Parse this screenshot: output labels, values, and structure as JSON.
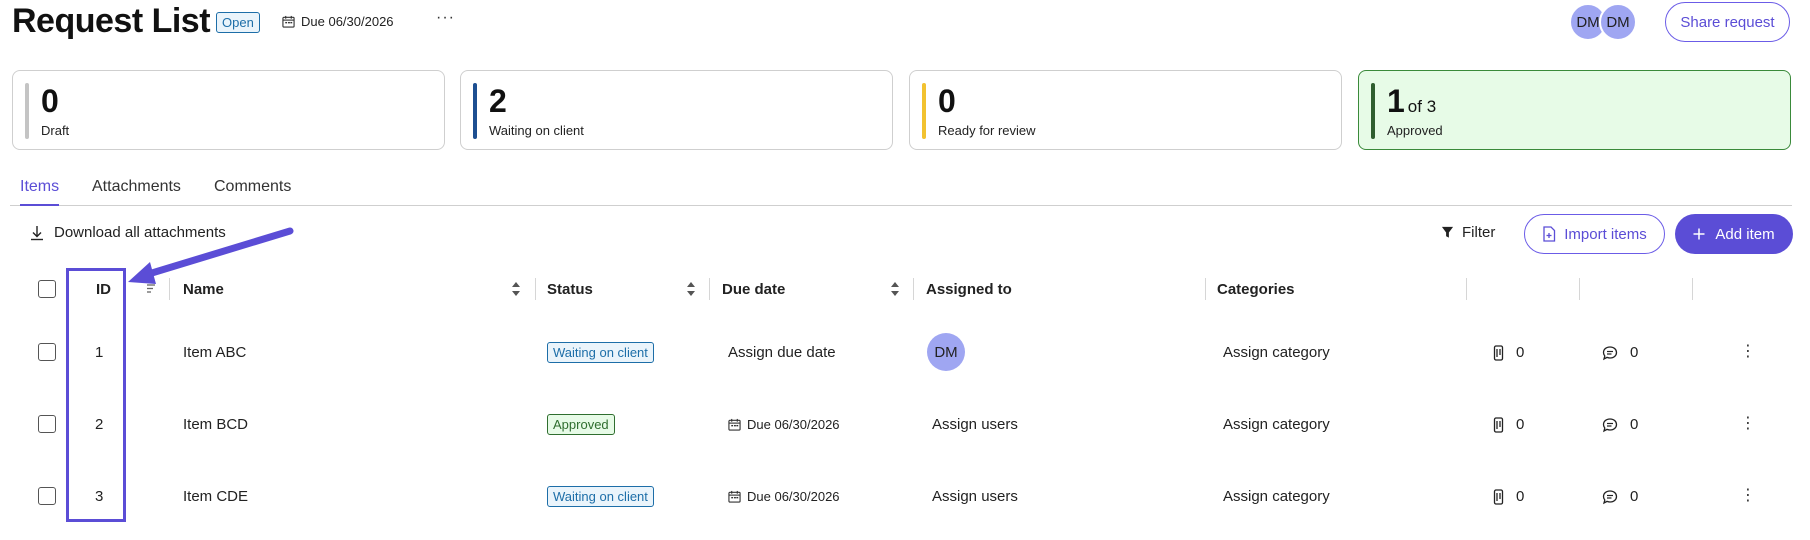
{
  "header": {
    "title": "Request List",
    "status": "Open",
    "due": "Due 06/30/2026",
    "more_label": "···",
    "avatars": [
      "DM",
      "DM"
    ],
    "share_label": "Share request"
  },
  "stats": [
    {
      "value": "0",
      "label": "Draft",
      "color": "#c4c4c4"
    },
    {
      "value": "2",
      "label": "Waiting on client",
      "color": "#1d4f91"
    },
    {
      "value": "0",
      "label": "Ready for review",
      "color": "#f2c230"
    },
    {
      "value": "1",
      "suffix": "of 3",
      "label": "Approved",
      "color": "#2f5e2f"
    }
  ],
  "tabs": [
    "Items",
    "Attachments",
    "Comments"
  ],
  "active_tab": "Items",
  "toolbar": {
    "download_label": "Download all attachments",
    "filter_label": "Filter",
    "import_label": "Import items",
    "add_label": "Add item"
  },
  "table": {
    "columns": [
      "ID",
      "Name",
      "Status",
      "Due date",
      "Assigned to",
      "Categories"
    ],
    "rows": [
      {
        "id": "1",
        "name": "Item ABC",
        "status": "Waiting on client",
        "due": "Assign due date",
        "assigned": "DM",
        "category": "Assign category",
        "attachments": "0",
        "comments": "0"
      },
      {
        "id": "2",
        "name": "Item BCD",
        "status": "Approved",
        "due": "Due 06/30/2026",
        "assigned": "Assign users",
        "category": "Assign category",
        "attachments": "0",
        "comments": "0"
      },
      {
        "id": "3",
        "name": "Item CDE",
        "status": "Waiting on client",
        "due": "Due 06/30/2026",
        "assigned": "Assign users",
        "category": "Assign category",
        "attachments": "0",
        "comments": "0"
      }
    ]
  },
  "colors": {
    "accent": "#5b4dd6",
    "approved_bg": "#e7fbe7",
    "waiting": "#1d6ea8"
  }
}
